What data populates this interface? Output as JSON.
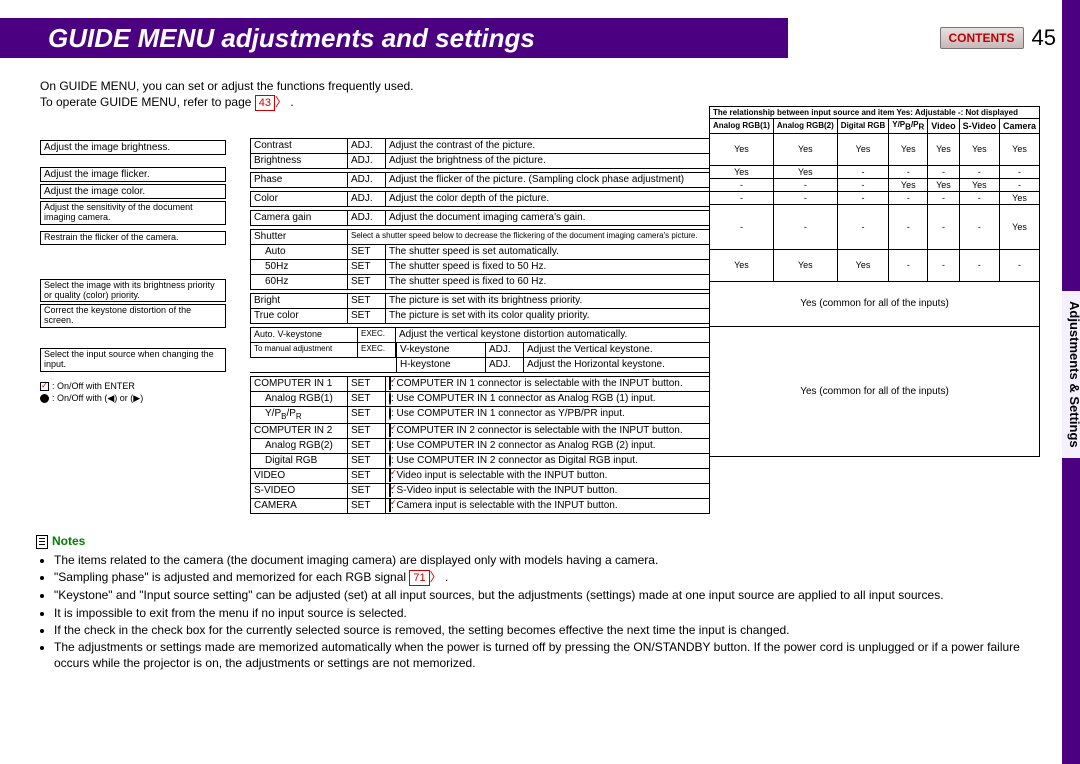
{
  "header": {
    "title": "GUIDE MENU adjustments and settings",
    "contents_btn": "CONTENTS",
    "page_num": "45"
  },
  "side_tab": "Adjustments & Settings",
  "intro": {
    "line1": "On GUIDE MENU, you can set or adjust the functions frequently used.",
    "line2a": "To operate GUIDE MENU, refer to page ",
    "page_ref": "43",
    "line2b": " ."
  },
  "matrix_header_note": "The relationship between input source and item   Yes: Adjustable   -: Not displayed",
  "matrix_cols": [
    "Analog RGB(1)",
    "Analog RGB(2)",
    "Digital RGB",
    "Y/PB/PR",
    "Video",
    "S-Video",
    "Camera"
  ],
  "matrix_rows": [
    [
      "Yes",
      "Yes",
      "Yes",
      "Yes",
      "Yes",
      "Yes",
      "Yes"
    ],
    [
      "Yes",
      "Yes",
      "-",
      "-",
      "-",
      "-",
      "-"
    ],
    [
      "-",
      "-",
      "-",
      "Yes",
      "Yes",
      "Yes",
      "-"
    ],
    [
      "-",
      "-",
      "-",
      "-",
      "-",
      "-",
      "Yes"
    ],
    [
      "-",
      "-",
      "-",
      "-",
      "-",
      "-",
      "Yes"
    ],
    [
      "Yes",
      "Yes",
      "Yes",
      "-",
      "-",
      "-",
      "-"
    ]
  ],
  "matrix_common": "Yes (common for all of the inputs)",
  "hints": [
    "Adjust the image brightness.",
    "Adjust the image flicker.",
    "Adjust the image color.",
    "Adjust the sensitivity of the document imaging camera.",
    "Restrain the flicker of the camera.",
    "Select the image with its brightness priority or quality (color) priority.",
    "Correct the keystone distortion of the screen.",
    "Select the input source when changing the input."
  ],
  "legend": {
    "l1": ": On/Off with ENTER",
    "l2": ": On/Off with (◀) or (▶)"
  },
  "rows": {
    "contrast": {
      "name": "Contrast",
      "tag": "ADJ.",
      "desc": "Adjust the contrast of the picture."
    },
    "brightness": {
      "name": "Brightness",
      "tag": "ADJ.",
      "desc": "Adjust the brightness of the picture."
    },
    "phase": {
      "name": "Phase",
      "tag": "ADJ.",
      "desc": "Adjust the flicker of the picture. (Sampling clock phase adjustment)"
    },
    "color": {
      "name": "Color",
      "tag": "ADJ.",
      "desc": "Adjust the color depth of the picture."
    },
    "camgain": {
      "name": "Camera gain",
      "tag": "ADJ.",
      "desc": "Adjust the document imaging camera's gain."
    },
    "shutter": {
      "name": "Shutter",
      "desc": "Select a shutter speed below to decrease the flickering of the document imaging camera's picture."
    },
    "auto": {
      "name": "Auto",
      "tag": "SET",
      "desc": "The shutter speed is set automatically."
    },
    "50hz": {
      "name": "50Hz",
      "tag": "SET",
      "desc": "The shutter speed is fixed to 50 Hz."
    },
    "60hz": {
      "name": "60Hz",
      "tag": "SET",
      "desc": "The shutter speed is fixed to 60 Hz."
    },
    "bright": {
      "name": "Bright",
      "tag": "SET",
      "desc": "The picture is set with its brightness priority."
    },
    "truecolor": {
      "name": "True color",
      "tag": "SET",
      "desc": "The picture is set with its color quality priority."
    },
    "autovk": {
      "name": "Auto. V-keystone",
      "tag": "EXEC.",
      "desc": "Adjust the vertical keystone distortion automatically."
    },
    "tomanual": {
      "name": "To manual adjustment",
      "tag": "EXEC."
    },
    "vkey": {
      "name": "V-keystone",
      "tag": "ADJ.",
      "desc": "Adjust the Vertical keystone."
    },
    "hkey": {
      "name": "H-keystone",
      "tag": "ADJ.",
      "desc": "Adjust the Horizontal keystone."
    },
    "cin1": {
      "name": "COMPUTER IN 1",
      "tag": "SET",
      "desc": ": COMPUTER IN 1 connector is selectable with the INPUT button."
    },
    "argb1": {
      "name": "Analog RGB(1)",
      "tag": "SET",
      "desc": ": Use COMPUTER IN 1 connector as Analog RGB (1) input."
    },
    "ypbpr": {
      "name": "Y/PB/PR",
      "tag": "SET",
      "desc": ": Use COMPUTER IN 1 connector as Y/PB/PR input."
    },
    "cin2": {
      "name": "COMPUTER IN 2",
      "tag": "SET",
      "desc": ": COMPUTER IN 2 connector is selectable with the INPUT button."
    },
    "argb2": {
      "name": "Analog RGB(2)",
      "tag": "SET",
      "desc": ": Use COMPUTER IN 2 connector as Analog RGB (2) input."
    },
    "drgb": {
      "name": "Digital RGB",
      "tag": "SET",
      "desc": ": Use COMPUTER IN 2 connector as Digital RGB input."
    },
    "video": {
      "name": "VIDEO",
      "tag": "SET",
      "desc": ": Video input is selectable with the INPUT button."
    },
    "svideo": {
      "name": "S-VIDEO",
      "tag": "SET",
      "desc": ": S-Video input is selectable with the INPUT button."
    },
    "camera": {
      "name": "CAMERA",
      "tag": "SET",
      "desc": ": Camera input is selectable with the INPUT button."
    }
  },
  "notes": {
    "header": "Notes",
    "items": [
      "The items related to the camera (the document imaging camera) are displayed only with models having a camera.",
      "\"Sampling phase\" is adjusted and memorized for each RGB signal ",
      "\"Keystone\" and \"Input source setting\" can be adjusted (set) at all input sources, but the adjustments (settings) made at one input source are applied to all input sources.",
      "It is impossible to exit from the menu if no input source is selected.",
      "If the check in the check box for the currently selected source is removed, the setting becomes effective the next time the input is changed.",
      "The adjustments or settings made are memorized automatically when the power is turned off by pressing the ON/STANDBY button. If the power cord is unplugged or if a power failure occurs while the projector is on, the adjustments or settings are not memorized."
    ],
    "page_ref2": "71"
  }
}
